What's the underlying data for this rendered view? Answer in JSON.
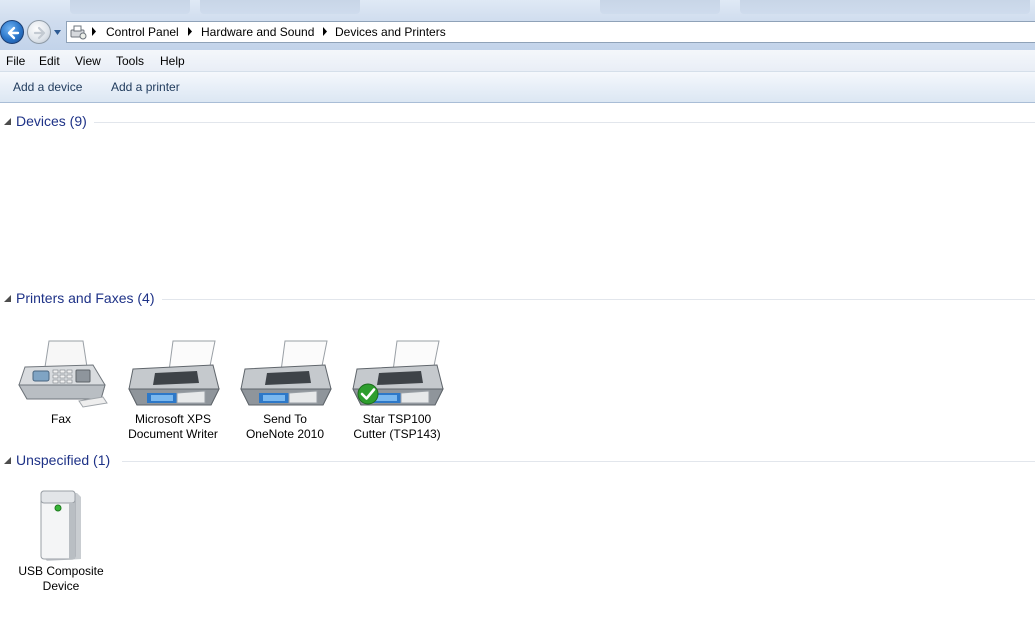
{
  "breadcrumb": {
    "items": [
      "Control Panel",
      "Hardware and Sound",
      "Devices and Printers"
    ]
  },
  "menu": {
    "items": [
      "File",
      "Edit",
      "View",
      "Tools",
      "Help"
    ]
  },
  "commands": {
    "add_device": "Add a device",
    "add_printer": "Add a printer"
  },
  "groups": {
    "devices": {
      "title": "Devices (9)"
    },
    "printers": {
      "title": "Printers and Faxes (4)",
      "items": [
        {
          "label": "Fax",
          "icon": "fax-icon"
        },
        {
          "label": "Microsoft XPS\nDocument Writer",
          "icon": "printer-icon"
        },
        {
          "label": "Send To\nOneNote 2010",
          "icon": "printer-icon"
        },
        {
          "label": "Star TSP100\nCutter (TSP143)",
          "icon": "printer-icon",
          "default": true
        }
      ]
    },
    "unspecified": {
      "title": "Unspecified (1)",
      "items": [
        {
          "label": "USB Composite\nDevice",
          "icon": "usb-device-icon"
        }
      ]
    }
  },
  "colors": {
    "group_title": "#1e3287",
    "command_text": "#1e395b",
    "default_check": "#2e9e2e"
  }
}
